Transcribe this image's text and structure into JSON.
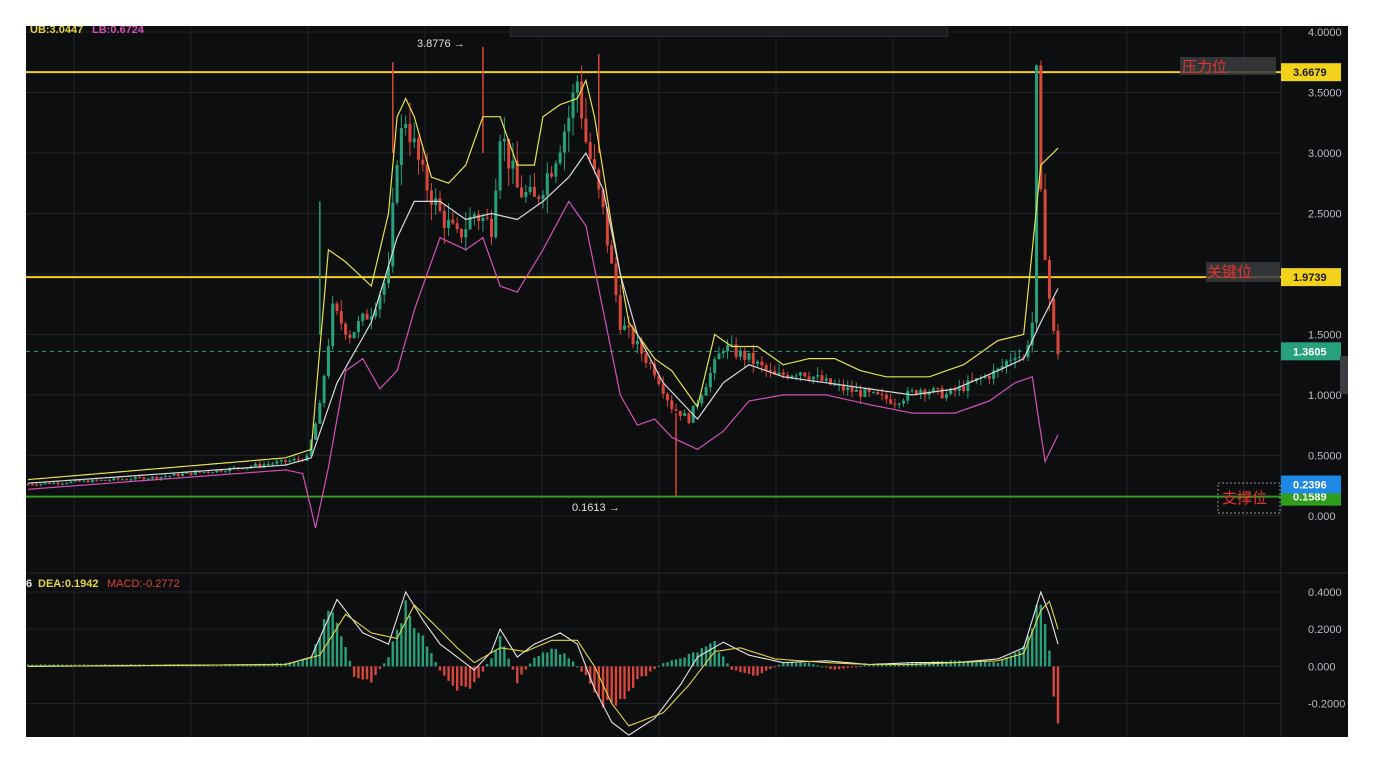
{
  "colors": {
    "background": "#0d0e10",
    "grid": "#1f2226",
    "resistance": "#f2d21b",
    "support": "#2f9e1e",
    "up_candle": "#26a17b",
    "down_candle": "#d9463a",
    "boll_upper": "#e8e14a",
    "boll_mid": "#d8d8d8",
    "boll_lower": "#d54fb7",
    "dif": "#e6e6e6",
    "dea": "#e6d443",
    "label_text": "#e8332c"
  },
  "header": {
    "ub_label": "UB:3.0447",
    "lb_label": "LB:0.6724",
    "dif_label": "6",
    "dea_label": "DEA:0.1942",
    "macd_label": "MACD:-0.2772"
  },
  "annotations": {
    "high_label": "3.8776 →",
    "low_label": "0.1613 →"
  },
  "levels": {
    "resistance": {
      "value": 3.6679,
      "tag": "3.6679",
      "text": "压力位"
    },
    "key": {
      "value": 1.9739,
      "tag": "1.9739",
      "text": "关键位"
    },
    "support": {
      "value": 0.1589,
      "tag": "0.1589",
      "text": "支撑位"
    },
    "current": {
      "value": 1.3605,
      "tag": "1.3605"
    },
    "support_alt": {
      "value": 0.2396,
      "tag": "0.2396"
    }
  },
  "chart_data": {
    "type": "candlestick",
    "price_axis": {
      "ticks": [
        "4.0000",
        "3.5000",
        "3.0000",
        "2.5000",
        "1.5000",
        "1.0000",
        "0.5000",
        "0.000"
      ],
      "ylim": [
        -0.1,
        4.0
      ]
    },
    "macd_axis": {
      "ticks": [
        "0.4000",
        "0.2000",
        "0.000",
        "-0.2000"
      ],
      "ylim": [
        -0.38,
        0.47
      ]
    },
    "candles_close_keypoints": [
      [
        0,
        0.26
      ],
      [
        10,
        0.28
      ],
      [
        30,
        0.32
      ],
      [
        45,
        0.38
      ],
      [
        60,
        0.45
      ],
      [
        65,
        0.48
      ],
      [
        68,
        0.9
      ],
      [
        71,
        1.7
      ],
      [
        75,
        1.5
      ],
      [
        80,
        1.7
      ],
      [
        84,
        2.0
      ],
      [
        86,
        3.0
      ],
      [
        88,
        3.3
      ],
      [
        92,
        2.8
      ],
      [
        96,
        2.5
      ],
      [
        100,
        2.3
      ],
      [
        104,
        2.5
      ],
      [
        108,
        2.4
      ],
      [
        110,
        3.2
      ],
      [
        114,
        2.7
      ],
      [
        118,
        2.6
      ],
      [
        122,
        2.9
      ],
      [
        126,
        3.3
      ],
      [
        128,
        3.6
      ],
      [
        130,
        3.1
      ],
      [
        134,
        2.5
      ],
      [
        138,
        1.6
      ],
      [
        142,
        1.4
      ],
      [
        146,
        1.2
      ],
      [
        150,
        0.9
      ],
      [
        154,
        0.8
      ],
      [
        158,
        1.1
      ],
      [
        162,
        1.4
      ],
      [
        168,
        1.3
      ],
      [
        174,
        1.15
      ],
      [
        180,
        1.2
      ],
      [
        186,
        1.1
      ],
      [
        190,
        1.05
      ],
      [
        196,
        1.0
      ],
      [
        202,
        0.95
      ],
      [
        208,
        1.05
      ],
      [
        214,
        1.0
      ],
      [
        220,
        1.1
      ],
      [
        226,
        1.2
      ],
      [
        230,
        1.35
      ],
      [
        232,
        1.3
      ],
      [
        234,
        1.6
      ],
      [
        235,
        3.6
      ],
      [
        236,
        2.6
      ],
      [
        237,
        2.2
      ],
      [
        238,
        1.8
      ],
      [
        239,
        1.5
      ],
      [
        240,
        1.36
      ]
    ],
    "boll_upper_keypoints": [
      [
        0,
        0.3
      ],
      [
        60,
        0.48
      ],
      [
        66,
        0.55
      ],
      [
        70,
        2.2
      ],
      [
        74,
        2.1
      ],
      [
        80,
        1.9
      ],
      [
        84,
        2.5
      ],
      [
        86,
        3.3
      ],
      [
        88,
        3.45
      ],
      [
        90,
        3.3
      ],
      [
        94,
        2.8
      ],
      [
        98,
        2.75
      ],
      [
        102,
        2.9
      ],
      [
        106,
        3.3
      ],
      [
        110,
        3.3
      ],
      [
        114,
        2.9
      ],
      [
        118,
        2.9
      ],
      [
        120,
        3.3
      ],
      [
        124,
        3.4
      ],
      [
        128,
        3.45
      ],
      [
        130,
        3.6
      ],
      [
        132,
        3.3
      ],
      [
        136,
        2.4
      ],
      [
        140,
        1.6
      ],
      [
        146,
        1.3
      ],
      [
        150,
        1.2
      ],
      [
        156,
        0.9
      ],
      [
        160,
        1.5
      ],
      [
        164,
        1.4
      ],
      [
        170,
        1.4
      ],
      [
        176,
        1.25
      ],
      [
        182,
        1.3
      ],
      [
        188,
        1.3
      ],
      [
        194,
        1.2
      ],
      [
        200,
        1.15
      ],
      [
        210,
        1.15
      ],
      [
        218,
        1.25
      ],
      [
        226,
        1.45
      ],
      [
        232,
        1.5
      ],
      [
        236,
        2.9
      ],
      [
        240,
        3.04
      ]
    ],
    "boll_mid_keypoints": [
      [
        0,
        0.27
      ],
      [
        60,
        0.42
      ],
      [
        66,
        0.48
      ],
      [
        72,
        1.1
      ],
      [
        80,
        1.6
      ],
      [
        86,
        2.3
      ],
      [
        90,
        2.6
      ],
      [
        96,
        2.6
      ],
      [
        102,
        2.45
      ],
      [
        108,
        2.5
      ],
      [
        114,
        2.45
      ],
      [
        120,
        2.6
      ],
      [
        126,
        2.8
      ],
      [
        130,
        3.0
      ],
      [
        134,
        2.7
      ],
      [
        138,
        2.0
      ],
      [
        142,
        1.5
      ],
      [
        148,
        1.1
      ],
      [
        152,
        0.95
      ],
      [
        156,
        0.8
      ],
      [
        162,
        1.1
      ],
      [
        168,
        1.25
      ],
      [
        176,
        1.15
      ],
      [
        186,
        1.1
      ],
      [
        196,
        1.05
      ],
      [
        206,
        1.0
      ],
      [
        216,
        1.05
      ],
      [
        226,
        1.2
      ],
      [
        232,
        1.3
      ],
      [
        236,
        1.6
      ],
      [
        240,
        1.88
      ]
    ],
    "boll_lower_keypoints": [
      [
        0,
        0.22
      ],
      [
        60,
        0.38
      ],
      [
        64,
        0.35
      ],
      [
        67,
        -0.1
      ],
      [
        70,
        0.4
      ],
      [
        74,
        1.2
      ],
      [
        78,
        1.3
      ],
      [
        82,
        1.05
      ],
      [
        86,
        1.2
      ],
      [
        90,
        1.7
      ],
      [
        96,
        2.3
      ],
      [
        102,
        2.2
      ],
      [
        106,
        2.3
      ],
      [
        110,
        1.9
      ],
      [
        114,
        1.85
      ],
      [
        120,
        2.2
      ],
      [
        126,
        2.6
      ],
      [
        130,
        2.4
      ],
      [
        134,
        1.7
      ],
      [
        138,
        1.0
      ],
      [
        142,
        0.75
      ],
      [
        146,
        0.8
      ],
      [
        150,
        0.65
      ],
      [
        156,
        0.55
      ],
      [
        162,
        0.7
      ],
      [
        168,
        0.95
      ],
      [
        176,
        1.0
      ],
      [
        186,
        1.0
      ],
      [
        196,
        0.92
      ],
      [
        206,
        0.85
      ],
      [
        216,
        0.85
      ],
      [
        224,
        0.95
      ],
      [
        230,
        1.1
      ],
      [
        234,
        1.15
      ],
      [
        237,
        0.45
      ],
      [
        240,
        0.67
      ]
    ],
    "macd_hist_keypoints": [
      [
        0,
        0.01
      ],
      [
        50,
        0.01
      ],
      [
        62,
        0.02
      ],
      [
        66,
        0.05
      ],
      [
        70,
        0.3
      ],
      [
        74,
        0.12
      ],
      [
        76,
        -0.05
      ],
      [
        80,
        -0.08
      ],
      [
        84,
        0.05
      ],
      [
        88,
        0.33
      ],
      [
        92,
        0.15
      ],
      [
        96,
        -0.02
      ],
      [
        100,
        -0.12
      ],
      [
        104,
        -0.1
      ],
      [
        108,
        0.05
      ],
      [
        110,
        0.16
      ],
      [
        114,
        -0.08
      ],
      [
        118,
        0.05
      ],
      [
        122,
        0.1
      ],
      [
        126,
        0.05
      ],
      [
        130,
        -0.05
      ],
      [
        134,
        -0.2
      ],
      [
        138,
        -0.18
      ],
      [
        142,
        -0.08
      ],
      [
        148,
        0.02
      ],
      [
        152,
        0.04
      ],
      [
        156,
        0.08
      ],
      [
        160,
        0.12
      ],
      [
        164,
        -0.02
      ],
      [
        170,
        -0.05
      ],
      [
        176,
        0.02
      ],
      [
        182,
        0.02
      ],
      [
        188,
        -0.02
      ],
      [
        196,
        0.01
      ],
      [
        206,
        0.02
      ],
      [
        216,
        0.03
      ],
      [
        226,
        0.02
      ],
      [
        232,
        0.1
      ],
      [
        236,
        0.36
      ],
      [
        238,
        0.1
      ],
      [
        239,
        -0.18
      ],
      [
        240,
        -0.28
      ]
    ],
    "dif_keypoints": [
      [
        0,
        0.0
      ],
      [
        60,
        0.01
      ],
      [
        66,
        0.05
      ],
      [
        72,
        0.36
      ],
      [
        78,
        0.18
      ],
      [
        84,
        0.12
      ],
      [
        88,
        0.4
      ],
      [
        92,
        0.25
      ],
      [
        96,
        0.12
      ],
      [
        100,
        0.05
      ],
      [
        104,
        -0.02
      ],
      [
        108,
        0.08
      ],
      [
        110,
        0.2
      ],
      [
        114,
        0.05
      ],
      [
        118,
        0.12
      ],
      [
        124,
        0.18
      ],
      [
        128,
        0.12
      ],
      [
        132,
        -0.12
      ],
      [
        136,
        -0.3
      ],
      [
        140,
        -0.37
      ],
      [
        146,
        -0.28
      ],
      [
        152,
        -0.1
      ],
      [
        156,
        0.05
      ],
      [
        162,
        0.13
      ],
      [
        168,
        0.06
      ],
      [
        176,
        0.02
      ],
      [
        186,
        0.03
      ],
      [
        196,
        0.01
      ],
      [
        206,
        0.02
      ],
      [
        216,
        0.02
      ],
      [
        226,
        0.04
      ],
      [
        232,
        0.1
      ],
      [
        236,
        0.4
      ],
      [
        238,
        0.28
      ],
      [
        240,
        0.12
      ]
    ],
    "dea_keypoints": [
      [
        0,
        0.0
      ],
      [
        60,
        0.01
      ],
      [
        68,
        0.06
      ],
      [
        74,
        0.28
      ],
      [
        80,
        0.18
      ],
      [
        86,
        0.15
      ],
      [
        90,
        0.33
      ],
      [
        94,
        0.24
      ],
      [
        100,
        0.1
      ],
      [
        104,
        0.02
      ],
      [
        110,
        0.1
      ],
      [
        116,
        0.08
      ],
      [
        122,
        0.14
      ],
      [
        128,
        0.14
      ],
      [
        132,
        0.0
      ],
      [
        136,
        -0.2
      ],
      [
        140,
        -0.32
      ],
      [
        148,
        -0.25
      ],
      [
        154,
        -0.1
      ],
      [
        160,
        0.08
      ],
      [
        166,
        0.1
      ],
      [
        174,
        0.04
      ],
      [
        186,
        0.02
      ],
      [
        196,
        0.01
      ],
      [
        206,
        0.01
      ],
      [
        216,
        0.02
      ],
      [
        226,
        0.03
      ],
      [
        232,
        0.07
      ],
      [
        236,
        0.3
      ],
      [
        238,
        0.35
      ],
      [
        240,
        0.2
      ]
    ]
  }
}
